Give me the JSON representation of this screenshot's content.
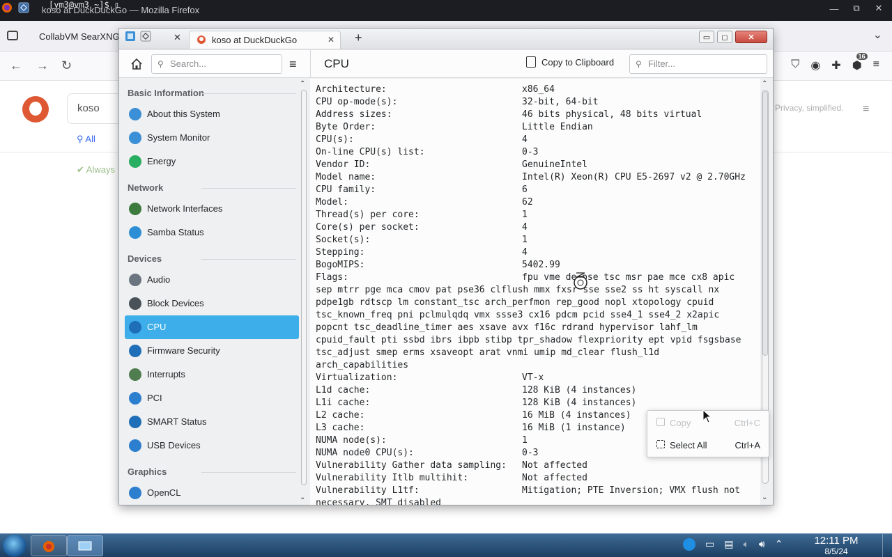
{
  "firefox": {
    "window_title": "koso at DuckDuckGo — Mozilla Firefox",
    "terminal_text": "[ym3@vm3 ~]$ ▯",
    "tab_label": "CollabVM SearXNG",
    "search_text": "koso",
    "tab_all": "All",
    "always_text": "Always",
    "privacy_text": "Privacy, simplified.",
    "notif_count": "16"
  },
  "kinfo": {
    "tab_title": "koso at DuckDuckGo",
    "search_placeholder": "Search...",
    "page_title": "CPU",
    "copy_label": "Copy to Clipboard",
    "filter_placeholder": "Filter..."
  },
  "sidebar": {
    "sections": [
      {
        "title": "Basic Information",
        "items": [
          {
            "label": "About this System",
            "icon": "info-icon",
            "color": "#3a8fd6"
          },
          {
            "label": "System Monitor",
            "icon": "monitor-icon",
            "color": "#3a8fd6"
          },
          {
            "label": "Energy",
            "icon": "energy-icon",
            "color": "#27ae60"
          }
        ]
      },
      {
        "title": "Network",
        "items": [
          {
            "label": "Network Interfaces",
            "icon": "network-card-icon",
            "color": "#3d7a3d"
          },
          {
            "label": "Samba Status",
            "icon": "samba-icon",
            "color": "#2c8fd6"
          }
        ]
      },
      {
        "title": "Devices",
        "items": [
          {
            "label": "Audio",
            "icon": "audio-icon",
            "color": "#6b7580"
          },
          {
            "label": "Block Devices",
            "icon": "disk-icon",
            "color": "#4a5259"
          },
          {
            "label": "CPU",
            "icon": "cpu-icon",
            "color": "#1e6fb8"
          },
          {
            "label": "Firmware Security",
            "icon": "firmware-icon",
            "color": "#1e6fb8"
          },
          {
            "label": "Interrupts",
            "icon": "interrupts-icon",
            "color": "#4f7d4f"
          },
          {
            "label": "PCI",
            "icon": "pci-icon",
            "color": "#2c7fcf"
          },
          {
            "label": "SMART Status",
            "icon": "smart-icon",
            "color": "#1e6fb8"
          },
          {
            "label": "USB Devices",
            "icon": "usb-icon",
            "color": "#2c7fcf"
          }
        ]
      },
      {
        "title": "Graphics",
        "items": [
          {
            "label": "OpenCL",
            "icon": "opencl-icon",
            "color": "#2c7fcf"
          }
        ]
      }
    ],
    "active_item": "CPU"
  },
  "cpu_info": {
    "rows_top": [
      {
        "key": "Architecture:",
        "value": "x86_64"
      },
      {
        "key": "CPU op-mode(s):",
        "value": "32-bit, 64-bit"
      },
      {
        "key": "Address sizes:",
        "value": "46 bits physical, 48 bits virtual"
      },
      {
        "key": "Byte Order:",
        "value": "Little Endian"
      },
      {
        "key": "CPU(s):",
        "value": "4"
      },
      {
        "key": "On-line CPU(s) list:",
        "value": "0-3"
      },
      {
        "key": "Vendor ID:",
        "value": "GenuineIntel"
      },
      {
        "key": "Model name:",
        "value": "Intel(R) Xeon(R) CPU E5-2697 v2 @ 2.70GHz"
      },
      {
        "key": "CPU family:",
        "value": "6"
      },
      {
        "key": "Model:",
        "value": "62"
      },
      {
        "key": "Thread(s) per core:",
        "value": "1"
      },
      {
        "key": "Core(s) per socket:",
        "value": "4"
      },
      {
        "key": "Socket(s):",
        "value": "1"
      },
      {
        "key": "Stepping:",
        "value": "4"
      },
      {
        "key": "BogoMIPS:",
        "value": "5402.99"
      }
    ],
    "flags_key": "Flags:",
    "flags_first": "fpu vme de pse tsc msr pae mce cx8 apic",
    "flags_rest": "sep mtrr pge mca cmov pat pse36 clflush mmx fxsr sse sse2 ss ht syscall nx\npdpe1gb rdtscp lm constant_tsc arch_perfmon rep_good nopl xtopology cpuid\ntsc_known_freq pni pclmulqdq vmx ssse3 cx16 pdcm pcid sse4_1 sse4_2 x2apic\npopcnt tsc_deadline_timer aes xsave avx f16c rdrand hypervisor lahf_lm\ncpuid_fault pti ssbd ibrs ibpb stibp tpr_shadow flexpriority ept vpid fsgsbase\ntsc_adjust smep erms xsaveopt arat vnmi umip md_clear flush_l1d\narch_capabilities",
    "rows_bottom": [
      {
        "key": "Virtualization:",
        "value": "VT-x"
      },
      {
        "key": "L1d cache:",
        "value": "128 KiB (4 instances)"
      },
      {
        "key": "L1i cache:",
        "value": "128 KiB (4 instances)"
      },
      {
        "key": "L2 cache:",
        "value": "16 MiB (4 instances)"
      },
      {
        "key": "L3 cache:",
        "value": "16 MiB (1 instance)"
      },
      {
        "key": "NUMA node(s):",
        "value": "1"
      },
      {
        "key": "NUMA node0 CPU(s):",
        "value": "0-3"
      },
      {
        "key": "Vulnerability Gather data sampling:",
        "value": "Not affected"
      },
      {
        "key": "Vulnerability Itlb multihit:",
        "value": "Not affected"
      },
      {
        "key": "Vulnerability L1tf:",
        "value": "Mitigation; PTE Inversion; VMX flush not"
      }
    ],
    "cut_line": "necessary, SMT disabled"
  },
  "context_menu": {
    "copy_label": "Copy",
    "copy_shortcut": "Ctrl+C",
    "select_all_label": "Select All",
    "select_all_shortcut": "Ctrl+A"
  },
  "taskbar": {
    "time": "12:11 PM",
    "date": "8/5/24"
  }
}
